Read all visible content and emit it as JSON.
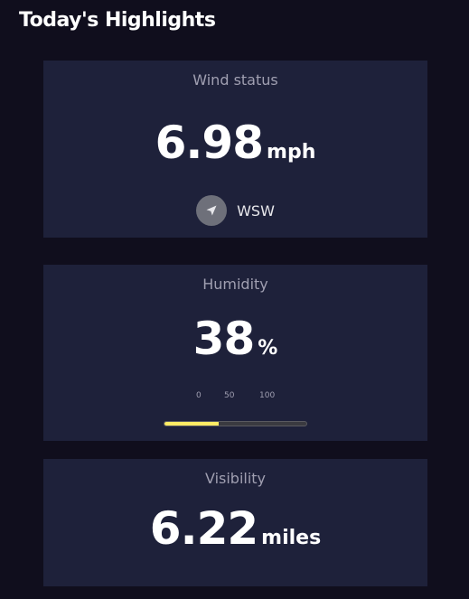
{
  "section": {
    "title": "Today's Highlights"
  },
  "wind": {
    "title": "Wind status",
    "value": "6.98",
    "unit": "mph",
    "direction_label": "WSW",
    "direction_icon": "navigation-arrow-icon"
  },
  "humidity": {
    "title": "Humidity",
    "value": "38",
    "unit": "%",
    "scale": [
      "0",
      "50",
      "100"
    ],
    "progress_percent": 38
  },
  "visibility": {
    "title": "Visibility",
    "value": "6.22",
    "unit": "miles"
  },
  "colors": {
    "background": "#100e1d",
    "card": "#1e213a",
    "bar_fill": "#ffec65",
    "muted_text": "#a09fb1"
  }
}
